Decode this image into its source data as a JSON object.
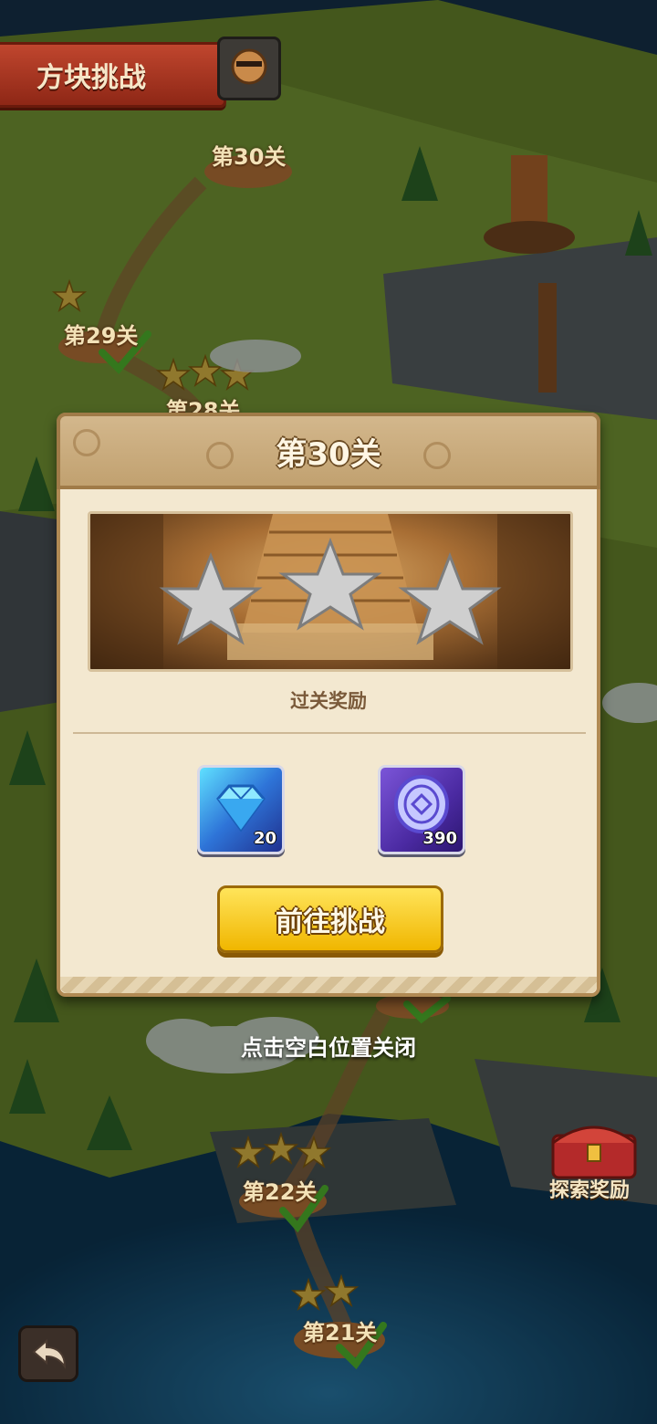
{
  "header": {
    "title": "方块挑战"
  },
  "map": {
    "nodes": [
      {
        "label": "第30关",
        "stars": 0,
        "cleared": false
      },
      {
        "label": "第29关",
        "stars": 1,
        "cleared": true
      },
      {
        "label": "第28关",
        "stars": 3,
        "cleared": true
      },
      {
        "label": "第22关",
        "stars": 3,
        "cleared": true
      },
      {
        "label": "第21关",
        "stars": 2,
        "cleared": true
      }
    ]
  },
  "dialog": {
    "title": "第30关",
    "stars_earned": 0,
    "stars_total": 3,
    "reward_label": "过关奖励",
    "rewards": [
      {
        "icon": "diamond-icon",
        "count": "20"
      },
      {
        "icon": "coin-icon",
        "count": "390"
      }
    ],
    "go_button_label": "前往挑战"
  },
  "close_hint": "点击空白位置关闭",
  "explore_reward": {
    "label": "探索奖励"
  },
  "colors": {
    "accent_yellow": "#ffd321",
    "header_tan": "#c9ad80",
    "panel_cream": "#f3e8d0",
    "banner_red": "#b03a24"
  }
}
